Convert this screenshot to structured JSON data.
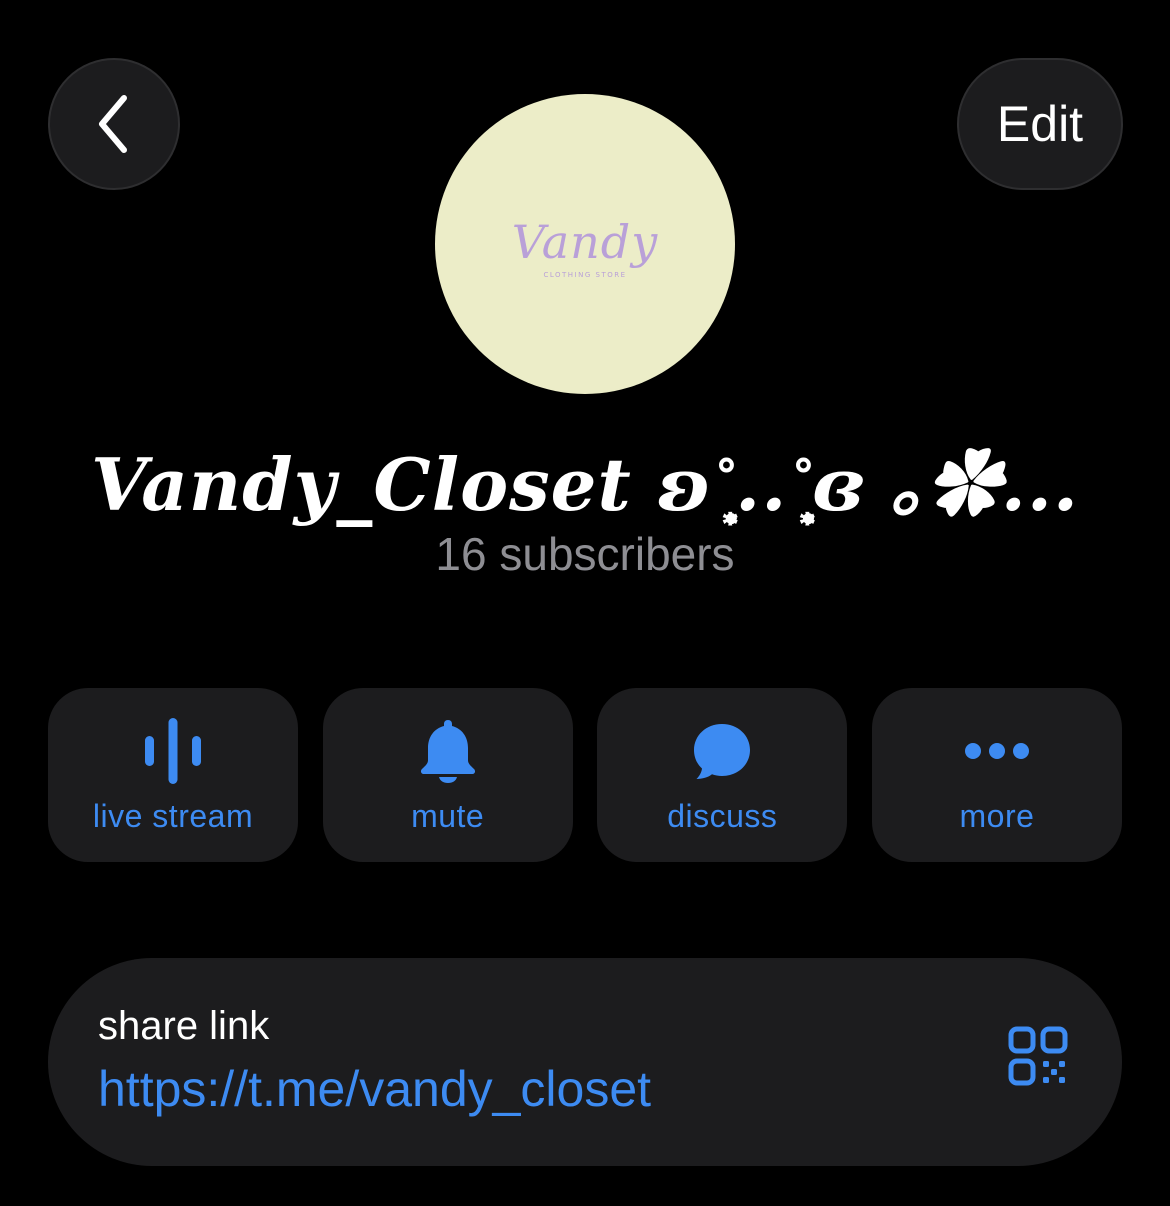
{
  "header": {
    "back_icon": "chevron-left-icon",
    "edit_label": "Edit"
  },
  "avatar": {
    "logo_text": "Vandy",
    "logo_subtext": "CLOTHING STORE",
    "background_color": "#ecedc8",
    "logo_color": "#b9a0d8"
  },
  "channel": {
    "title": "Vandy_Closet ʚ˚̣̣̣͙..˚̣̣̣͙ɞ ｡✿...",
    "subscribers": "16 subscribers"
  },
  "actions": [
    {
      "label": "live stream",
      "icon": "live-stream-icon"
    },
    {
      "label": "mute",
      "icon": "bell-icon"
    },
    {
      "label": "discuss",
      "icon": "chat-bubble-icon"
    },
    {
      "label": "more",
      "icon": "ellipsis-icon"
    }
  ],
  "share": {
    "label": "share link",
    "url": "https://t.me/vandy_closet",
    "qr_icon": "qr-code-icon"
  },
  "colors": {
    "background": "#000000",
    "card": "#1c1c1e",
    "accent": "#3d8bf2",
    "secondary_text": "#8e8e93"
  }
}
